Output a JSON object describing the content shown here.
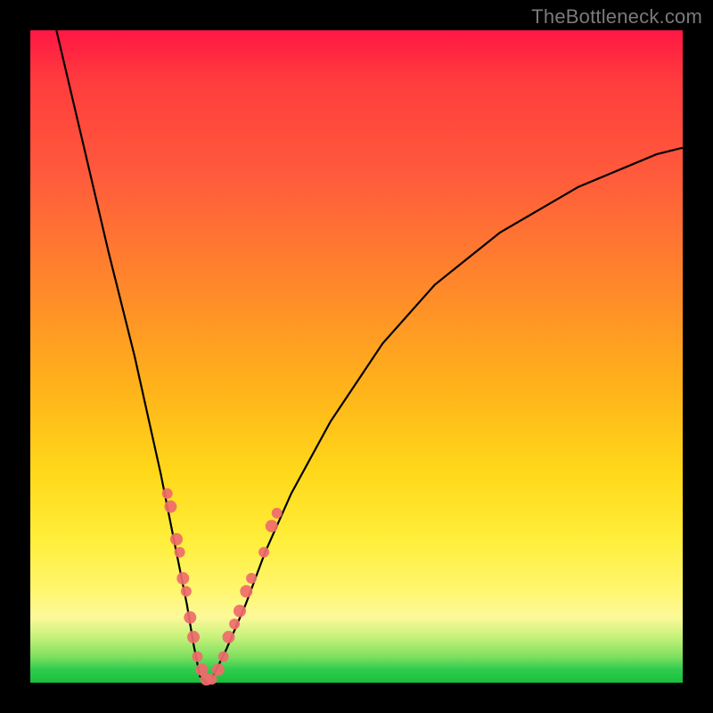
{
  "watermark": {
    "text": "TheBottleneck.com"
  },
  "colors": {
    "frame": "#000000",
    "marker": "#ef6b6b",
    "curve": "#000000",
    "gradient_stops": [
      "#ff1744",
      "#ff5a3c",
      "#ffb31a",
      "#ffee3a",
      "#2ecc4f"
    ]
  },
  "chart_data": {
    "type": "line",
    "title": "",
    "xlabel": "",
    "ylabel": "",
    "xlim": [
      0,
      100
    ],
    "ylim": [
      0,
      100
    ],
    "grid": false,
    "legend": false,
    "series": [
      {
        "name": "bottleneck-curve",
        "x": [
          4,
          8,
          12,
          16,
          20,
          22,
          24,
          25,
          26,
          27,
          28,
          30,
          33,
          36,
          40,
          46,
          54,
          62,
          72,
          84,
          96,
          100
        ],
        "y": [
          100,
          83,
          66,
          50,
          32,
          22,
          12,
          6,
          1,
          0,
          1,
          5,
          12,
          20,
          29,
          40,
          52,
          61,
          69,
          76,
          81,
          82
        ]
      }
    ],
    "markers": [
      {
        "x": 21.0,
        "y": 29,
        "r": 6
      },
      {
        "x": 21.5,
        "y": 27,
        "r": 7
      },
      {
        "x": 22.4,
        "y": 22,
        "r": 7
      },
      {
        "x": 22.9,
        "y": 20,
        "r": 6
      },
      {
        "x": 23.4,
        "y": 16,
        "r": 7
      },
      {
        "x": 23.9,
        "y": 14,
        "r": 6
      },
      {
        "x": 24.5,
        "y": 10,
        "r": 7
      },
      {
        "x": 25.0,
        "y": 7,
        "r": 7
      },
      {
        "x": 25.6,
        "y": 4,
        "r": 6
      },
      {
        "x": 26.3,
        "y": 2,
        "r": 7
      },
      {
        "x": 27.0,
        "y": 0.5,
        "r": 7
      },
      {
        "x": 27.8,
        "y": 0.5,
        "r": 6
      },
      {
        "x": 28.8,
        "y": 2,
        "r": 7
      },
      {
        "x": 29.6,
        "y": 4,
        "r": 6
      },
      {
        "x": 30.4,
        "y": 7,
        "r": 7
      },
      {
        "x": 31.3,
        "y": 9,
        "r": 6
      },
      {
        "x": 32.1,
        "y": 11,
        "r": 7
      },
      {
        "x": 33.1,
        "y": 14,
        "r": 7
      },
      {
        "x": 33.9,
        "y": 16,
        "r": 6
      },
      {
        "x": 35.8,
        "y": 20,
        "r": 6
      },
      {
        "x": 37.0,
        "y": 24,
        "r": 7
      },
      {
        "x": 37.8,
        "y": 26,
        "r": 6
      }
    ]
  }
}
